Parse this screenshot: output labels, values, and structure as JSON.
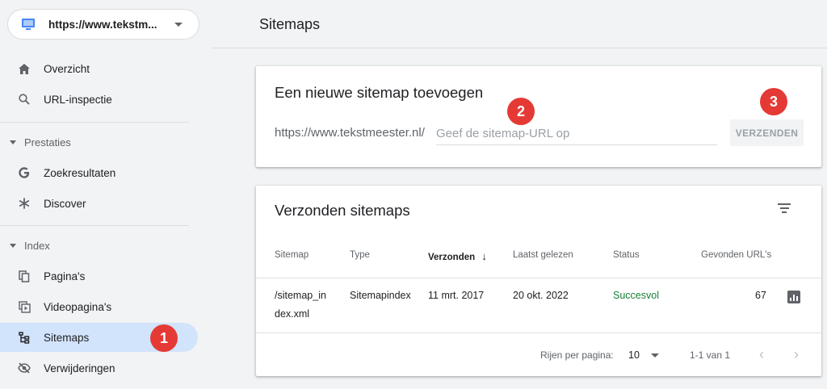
{
  "property": {
    "label": "https://www.tekstm...",
    "icon": "website-icon"
  },
  "nav": {
    "overview": "Overzicht",
    "url_inspection": "URL-inspectie",
    "performance_header": "Prestaties",
    "search_results": "Zoekresultaten",
    "discover": "Discover",
    "index_header": "Index",
    "pages": "Pagina's",
    "video_pages": "Videopagina's",
    "sitemaps": "Sitemaps",
    "removals": "Verwijderingen"
  },
  "header": {
    "title": "Sitemaps"
  },
  "add_card": {
    "title": "Een nieuwe sitemap toevoegen",
    "prefix": "https://www.tekstmeester.nl/",
    "placeholder": "Geef de sitemap-URL op",
    "submit": "VERZENDEN"
  },
  "submitted_card": {
    "title": "Verzonden sitemaps",
    "columns": {
      "sitemap": "Sitemap",
      "type": "Type",
      "submitted": "Verzonden",
      "sort_arrow": "↓",
      "last_read": "Laatst gelezen",
      "status": "Status",
      "found_urls": "Gevonden URL's"
    },
    "rows": [
      {
        "sitemap_line1": "/sitemap_in",
        "sitemap_line2": "dex.xml",
        "type": "Sitemapindex",
        "submitted": "11 mrt. 2017",
        "last_read": "20 okt. 2022",
        "status": "Succesvol",
        "found_urls": "67"
      }
    ],
    "pager": {
      "rows_per_page_label": "Rijen per pagina:",
      "rows_per_page": "10",
      "range": "1-1 van 1",
      "prev": "‹",
      "next": "›"
    }
  },
  "badges": [
    "1",
    "2",
    "3"
  ],
  "colors": {
    "active_nav": "#d2e3fc",
    "badge": "#e53935",
    "success": "#188038"
  }
}
